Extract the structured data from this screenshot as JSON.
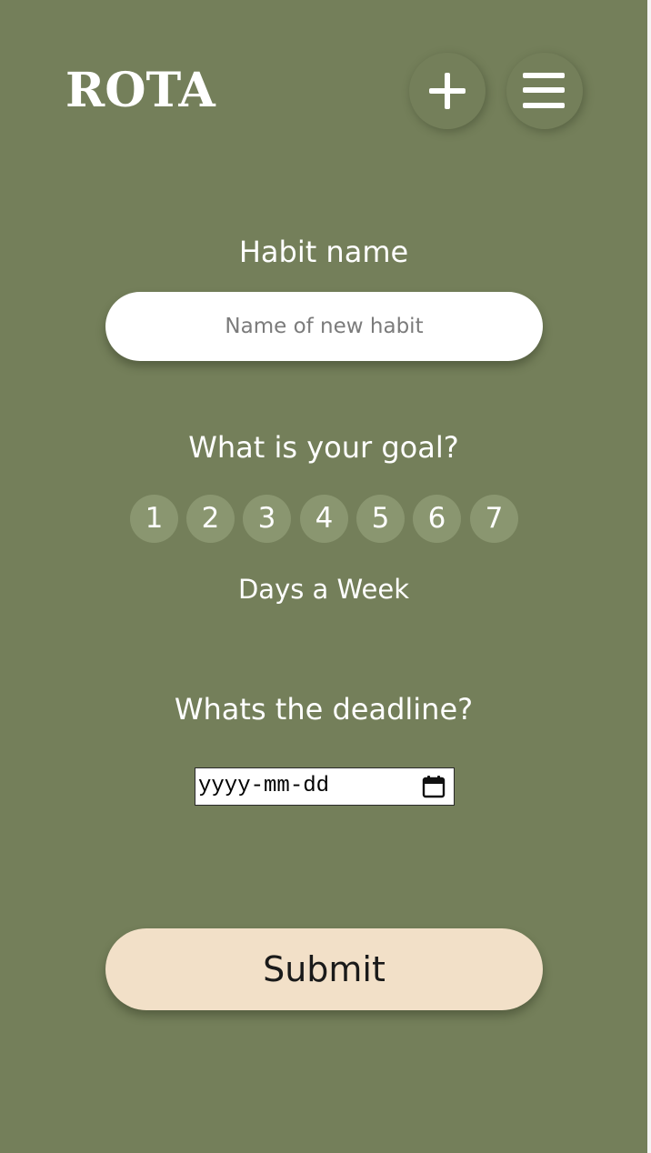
{
  "header": {
    "brand": "ROTA",
    "add_icon": "plus-icon",
    "menu_icon": "hamburger-menu-icon"
  },
  "habit": {
    "label": "Habit name",
    "placeholder": "Name of new habit",
    "value": ""
  },
  "goal": {
    "question": "What is your goal?",
    "options": [
      "1",
      "2",
      "3",
      "4",
      "5",
      "6",
      "7"
    ],
    "unit_label": "Days a Week"
  },
  "deadline": {
    "question": "Whats the deadline?",
    "date_placeholder": "yyyy-mm-dd",
    "calendar_icon": "calendar-icon"
  },
  "submit": {
    "label": "Submit"
  },
  "colors": {
    "background": "#747f5a",
    "goal_circle": "#8a9670",
    "submit_button": "#f2e0c8",
    "text_light": "#ffffff"
  }
}
